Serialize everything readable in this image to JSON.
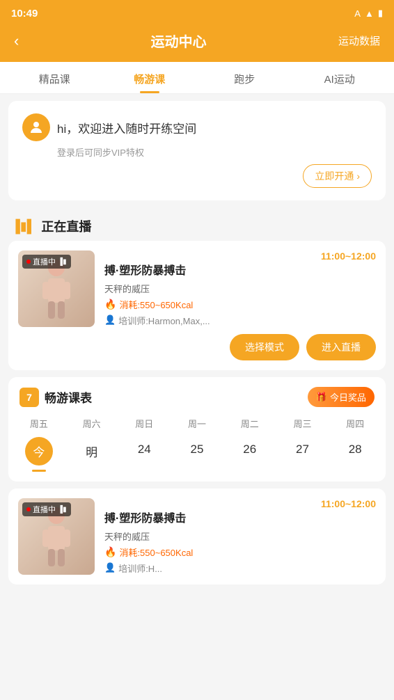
{
  "statusBar": {
    "time": "10:49",
    "icons": [
      "A",
      "wifi",
      "battery"
    ]
  },
  "header": {
    "backLabel": "‹",
    "title": "运动中心",
    "rightLabel": "运动数据"
  },
  "tabs": [
    {
      "label": "精品课",
      "active": false
    },
    {
      "label": "畅游课",
      "active": true
    },
    {
      "label": "跑步",
      "active": false
    },
    {
      "label": "AI运动",
      "active": false
    }
  ],
  "welcomeBanner": {
    "greeting": "hi，欢迎进入随时开练空间",
    "subtext": "登录后可同步VIP特权",
    "ctaLabel": "立即开通",
    "ctaArrow": "›"
  },
  "liveSection": {
    "title": "正在直播",
    "card": {
      "badgeLabel": "直播中",
      "timeRange": "11:00~12:00",
      "title": "搏·塑形防暴搏击",
      "subtitle": "天秤的威压",
      "calories": "消耗:550~650Kcal",
      "trainer": "培训师:Harmon,Max,...",
      "btn1": "选择模式",
      "btn2": "进入直播"
    }
  },
  "scheduleSection": {
    "calendarNum": "7",
    "title": "畅游课表",
    "rewardLabel": "今日奖品",
    "days": [
      {
        "name": "周五",
        "num": "今",
        "isToday": true
      },
      {
        "name": "周六",
        "num": "明",
        "isToday": false
      },
      {
        "name": "周日",
        "num": "24",
        "isToday": false
      },
      {
        "name": "周一",
        "num": "25",
        "isToday": false
      },
      {
        "name": "周二",
        "num": "26",
        "isToday": false
      },
      {
        "name": "周三",
        "num": "27",
        "isToday": false
      },
      {
        "name": "周四",
        "num": "28",
        "isToday": false
      }
    ]
  },
  "liveCard2": {
    "badgeLabel": "直播中",
    "timeRange": "11:00~12:00",
    "title": "搏·塑形防暴搏击",
    "subtitle": "天秤的威压",
    "calories": "消耗:550~650Kcal",
    "trainer": "培训师:H..."
  }
}
